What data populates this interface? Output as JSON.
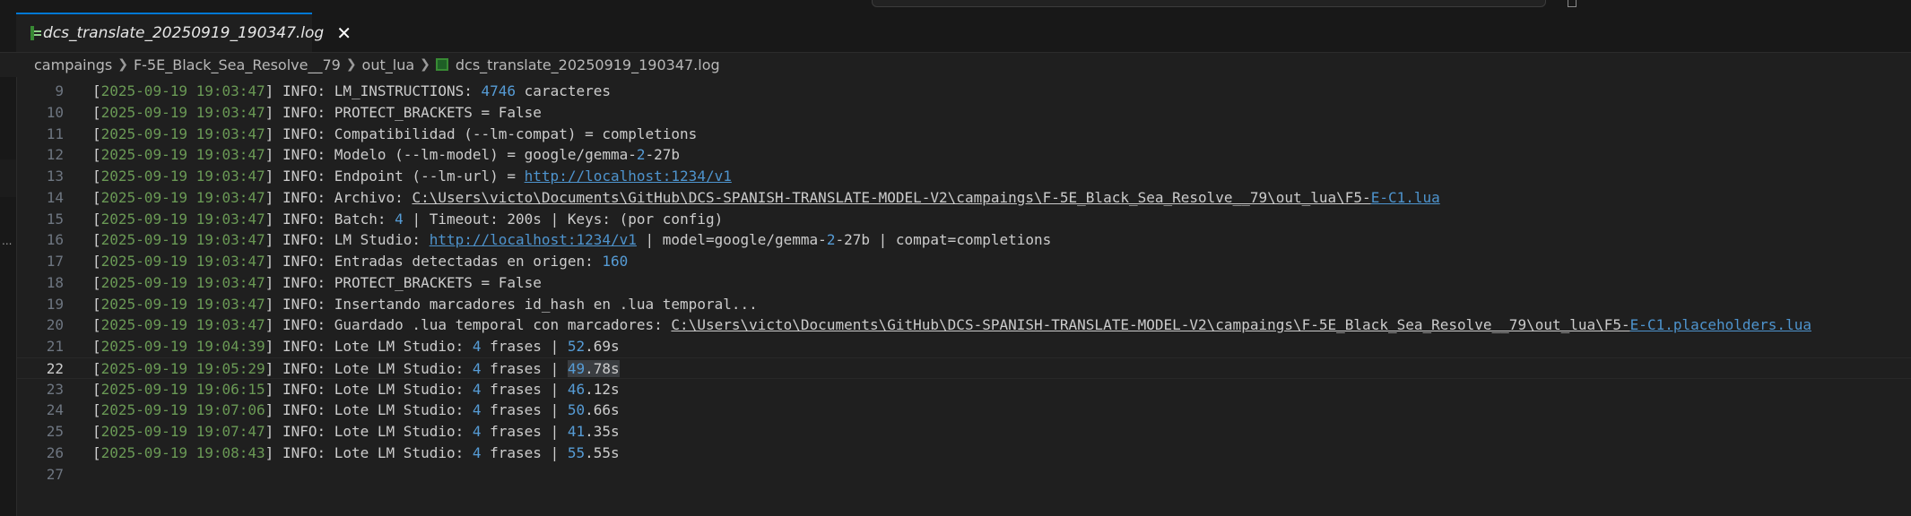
{
  "tab": {
    "label": "dcs_translate_20250919_190347.log",
    "close": "✕"
  },
  "breadcrumb": [
    "campaings",
    "F-5E_Black_Sea_Resolve__79",
    "out_lua",
    "dcs_translate_20250919_190347.log"
  ],
  "lines": [
    {
      "num": "9",
      "date": "2025-09-19 19:03:47",
      "a": "INFO: LM_INSTRUCTIONS: ",
      "b": "4746",
      "c": " caracteres"
    },
    {
      "num": "10",
      "date": "2025-09-19 19:03:47",
      "a": "INFO: PROTECT_BRACKETS = False"
    },
    {
      "num": "11",
      "date": "2025-09-19 19:03:47",
      "a": "INFO: Compatibilidad (--lm-compat) = completions"
    },
    {
      "num": "12",
      "date": "2025-09-19 19:03:47",
      "a": "INFO: Modelo (--lm-model) = google/gemma-",
      "b": "2",
      "c": "-27b"
    },
    {
      "num": "13",
      "date": "2025-09-19 19:03:47",
      "a": "INFO: Endpoint (--lm-url) = ",
      "url": "http://localhost:1234/v1"
    },
    {
      "num": "14",
      "date": "2025-09-19 19:03:47",
      "a": "INFO: Archivo: ",
      "path": "C:\\Users\\victo\\Documents\\GitHub\\DCS-SPANISH-TRANSLATE-MODEL-V2\\campaings\\F-5E_Black_Sea_Resolve__79\\out_lua\\F5-",
      "url": "E-C1.lua"
    },
    {
      "num": "15",
      "date": "2025-09-19 19:03:47",
      "a": "INFO: Batch: ",
      "b": "4",
      "c": " | Timeout: 200s | Keys: (por config)"
    },
    {
      "num": "16",
      "date": "2025-09-19 19:03:47",
      "a": "INFO: LM Studio: ",
      "url": "http://localhost:1234/v1",
      "d": " | model=google/gemma-",
      "e": "2",
      "f": "-27b | compat=completions"
    },
    {
      "num": "17",
      "date": "2025-09-19 19:03:47",
      "a": "INFO: Entradas detectadas en origen: ",
      "b": "160"
    },
    {
      "num": "18",
      "date": "2025-09-19 19:03:47",
      "a": "INFO: PROTECT_BRACKETS = False"
    },
    {
      "num": "19",
      "date": "2025-09-19 19:03:47",
      "a": "INFO: Insertando marcadores id_hash en .lua temporal..."
    },
    {
      "num": "20",
      "date": "2025-09-19 19:03:47",
      "a": "INFO: Guardado .lua temporal con marcadores: ",
      "path": "C:\\Users\\victo\\Documents\\GitHub\\DCS-SPANISH-TRANSLATE-MODEL-V2\\campaings\\F-5E_Black_Sea_Resolve__79\\out_lua\\F5-",
      "url": "E-C1.placeholders.lua"
    },
    {
      "num": "21",
      "date": "2025-09-19 19:04:39",
      "a": "INFO: Lote LM Studio: ",
      "b": "4",
      "c": " frases | ",
      "g": "52",
      "h": ".69s"
    },
    {
      "num": "22",
      "date": "2025-09-19 19:05:29",
      "a": "INFO: Lote LM Studio: ",
      "b": "4",
      "c": " frases | ",
      "g": "49",
      "h": ".78s",
      "current": true
    },
    {
      "num": "23",
      "date": "2025-09-19 19:06:15",
      "a": "INFO: Lote LM Studio: ",
      "b": "4",
      "c": " frases | ",
      "g": "46",
      "h": ".12s"
    },
    {
      "num": "24",
      "date": "2025-09-19 19:07:06",
      "a": "INFO: Lote LM Studio: ",
      "b": "4",
      "c": " frases | ",
      "g": "50",
      "h": ".66s"
    },
    {
      "num": "25",
      "date": "2025-09-19 19:07:47",
      "a": "INFO: Lote LM Studio: ",
      "b": "4",
      "c": " frases | ",
      "g": "41",
      "h": ".35s"
    },
    {
      "num": "26",
      "date": "2025-09-19 19:08:43",
      "a": "INFO: Lote LM Studio: ",
      "b": "4",
      "c": " frases | ",
      "g": "55",
      "h": ".55s"
    },
    {
      "num": "27"
    }
  ],
  "colors": {
    "accent": "#0078d4",
    "date": "#6a9955",
    "number": "#569cd6",
    "link": "#4e94ce"
  },
  "icons": {
    "file": "log-file-icon",
    "close": "close-icon"
  }
}
